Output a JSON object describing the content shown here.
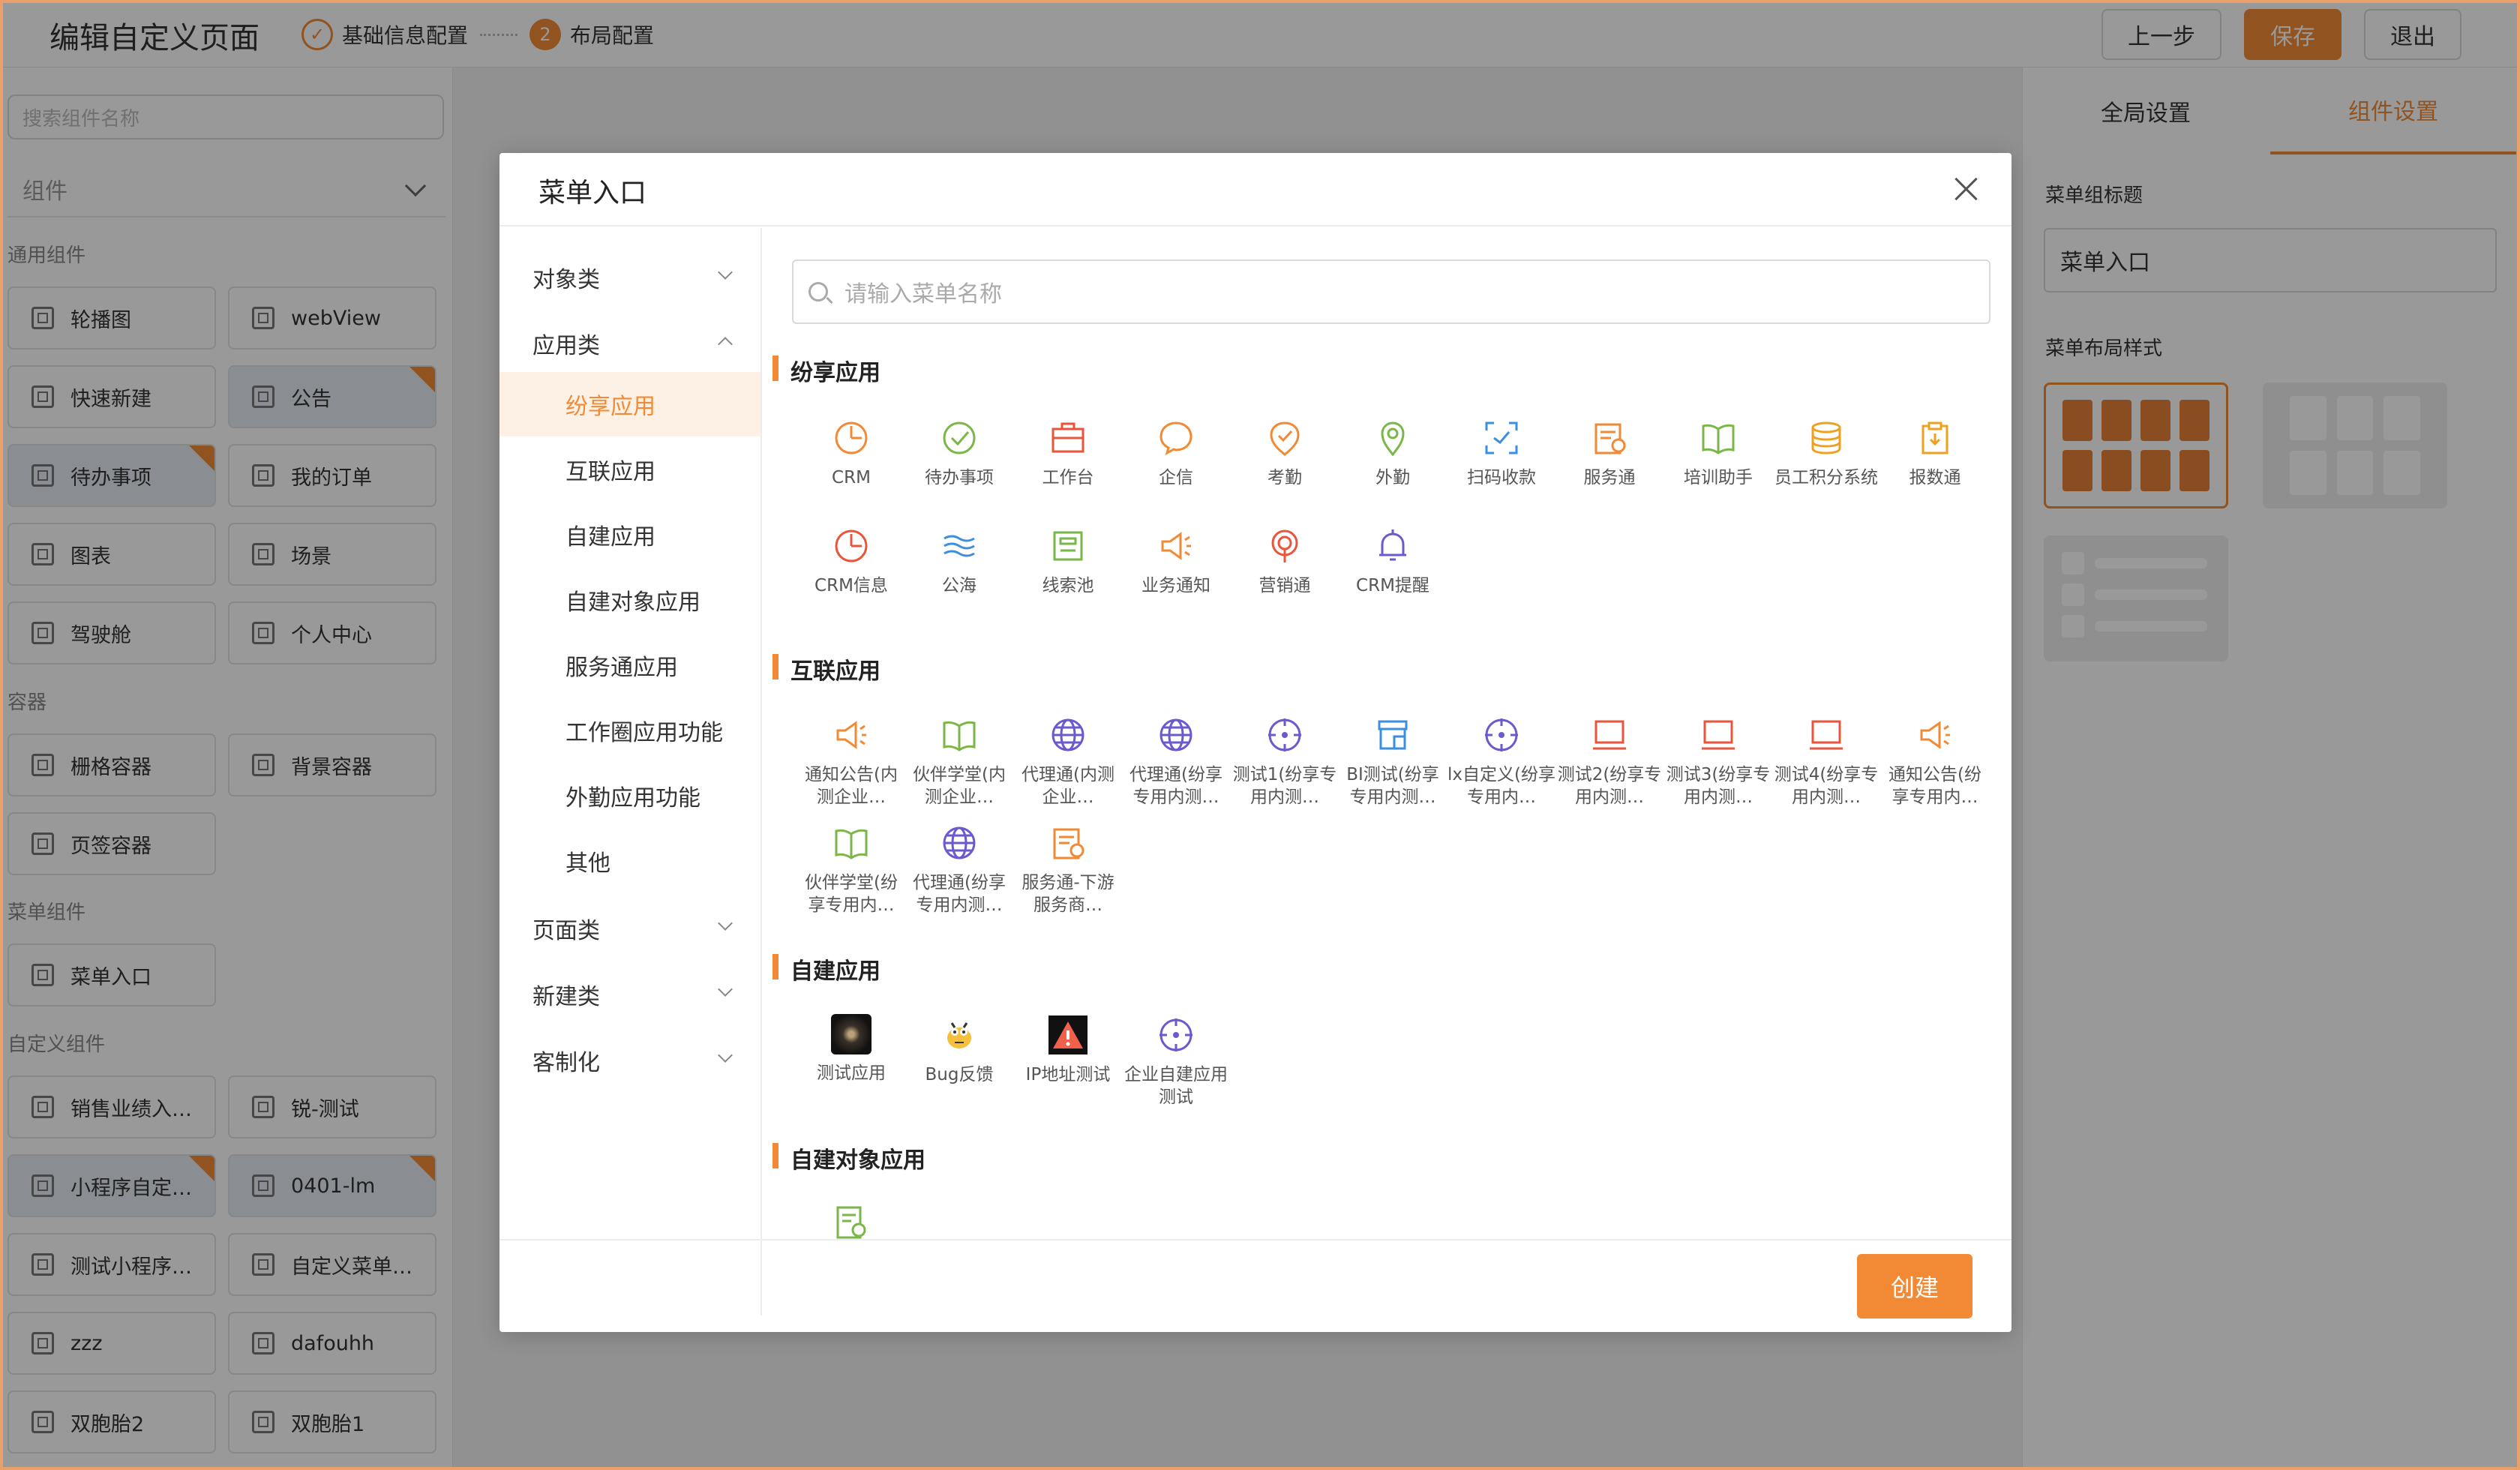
{
  "header": {
    "title": "编辑自定义页面",
    "step1": "基础信息配置",
    "step2_num": "2",
    "step2": "布局配置",
    "prev": "上一步",
    "save": "保存",
    "exit": "退出"
  },
  "left": {
    "search_placeholder": "搜索组件名称",
    "select": "组件",
    "groups": [
      "通用组件",
      "容器",
      "菜单组件",
      "自定义组件"
    ],
    "items": [
      "轮播图",
      "webView",
      "快速新建",
      "公告",
      "待办事项",
      "我的订单",
      "图表",
      "场景",
      "驾驶舱",
      "个人中心",
      "栅格容器",
      "背景容器",
      "页签容器",
      "菜单入口",
      "销售业绩入…",
      "锐-测试",
      "小程序自定…",
      "0401-lm",
      "测试小程序…",
      "自定义菜单…",
      "zzz",
      "dafouhh",
      "双胞胎2",
      "双胞胎1"
    ]
  },
  "right": {
    "tab1": "全局设置",
    "tab2": "组件设置",
    "title_label": "菜单组标题",
    "title_value": "菜单入口",
    "layout_label": "菜单布局样式"
  },
  "modal": {
    "title": "菜单入口",
    "search_placeholder": "请输入菜单名称",
    "create": "创建",
    "nav": {
      "cat1": "对象类",
      "cat2": "应用类",
      "subs": [
        "纷享应用",
        "互联应用",
        "自建应用",
        "自建对象应用",
        "服务通应用",
        "工作圈应用功能",
        "外勤应用功能",
        "其他"
      ],
      "cat3": "页面类",
      "cat4": "新建类",
      "cat5": "客制化"
    },
    "sections": {
      "s1": "纷享应用",
      "s2": "互联应用",
      "s3": "自建应用",
      "s4": "自建对象应用"
    },
    "apps1": [
      "CRM",
      "待办事项",
      "工作台",
      "企信",
      "考勤",
      "外勤",
      "扫码收款",
      "服务通",
      "培训助手",
      "员工积分系统",
      "报数通",
      "CRM信息",
      "公海",
      "线索池",
      "业务通知",
      "营销通",
      "CRM提醒"
    ],
    "apps2": [
      "通知公告(内测企业…",
      "伙伴学堂(内测企业…",
      "代理通(内测企业…",
      "代理通(纷享专用内测…",
      "测试1(纷享专用内测…",
      "BI测试(纷享专用内测…",
      "lx自定义(纷享专用内…",
      "测试2(纷享专用内测…",
      "测试3(纷享专用内测…",
      "测试4(纷享专用内测…",
      "通知公告(纷享专用内…",
      "伙伴学堂(纷享专用内…",
      "代理通(纷享专用内测…",
      "服务通-下游服务商…"
    ],
    "apps3": [
      "测试应用",
      "Bug反馈",
      "IP地址测试",
      "企业自建应用测试"
    ]
  },
  "colors": {
    "accent": "#f28a35",
    "blue": "#3b8fe0",
    "green": "#7ab648",
    "purple": "#6a5acd"
  }
}
